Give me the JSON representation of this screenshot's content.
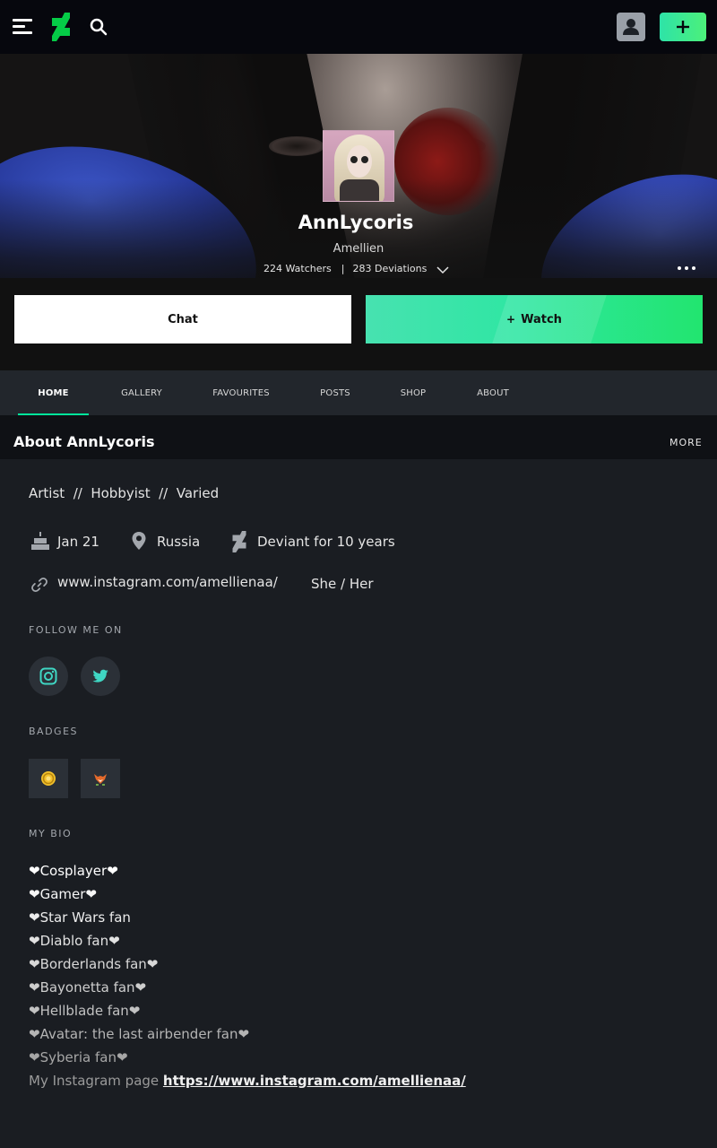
{
  "topbar": {
    "menu_icon": "hamburger-icon",
    "logo_icon": "deviantart-logo",
    "search_icon": "search-icon",
    "user_icon": "user-icon",
    "submit_icon": "plus-icon",
    "accent_color": "#00e59b"
  },
  "profile": {
    "username": "AnnLycoris",
    "tagline": "Amellien",
    "watchers": "224 Watchers",
    "separator": "|",
    "deviations": "283 Deviations",
    "chat_label": "Chat",
    "watch_plus": "+",
    "watch_label": "Watch"
  },
  "tabs": [
    {
      "label": "HOME",
      "active": true
    },
    {
      "label": "GALLERY"
    },
    {
      "label": "FAVOURITES"
    },
    {
      "label": "POSTS"
    },
    {
      "label": "SHOP"
    },
    {
      "label": "ABOUT"
    }
  ],
  "about": {
    "title": "About AnnLycoris",
    "more": "MORE",
    "roles": "Artist  //  Hobbyist  //  Varied",
    "birthday": "Jan 21",
    "location": "Russia",
    "member_since": "Deviant for 10 years",
    "website": "www.instagram.com/amellienaa/",
    "pronouns": "She / Her",
    "follow_label": "FOLLOW ME ON",
    "badges_label": "BADGES",
    "bio_label": "MY BIO"
  },
  "bio": {
    "lines": [
      "❤Cosplayer❤",
      "❤Gamer❤",
      "❤Star Wars fan",
      "❤Diablo fan❤",
      "❤Borderlands fan❤",
      "❤Bayonetta fan❤",
      "❤Hellblade fan❤",
      "❤Avatar: the last airbender fan❤",
      "❤Syberia fan❤"
    ],
    "instagram_prefix": "My Instagram page ",
    "instagram_url": "https://www.instagram.com/amellienaa/"
  }
}
